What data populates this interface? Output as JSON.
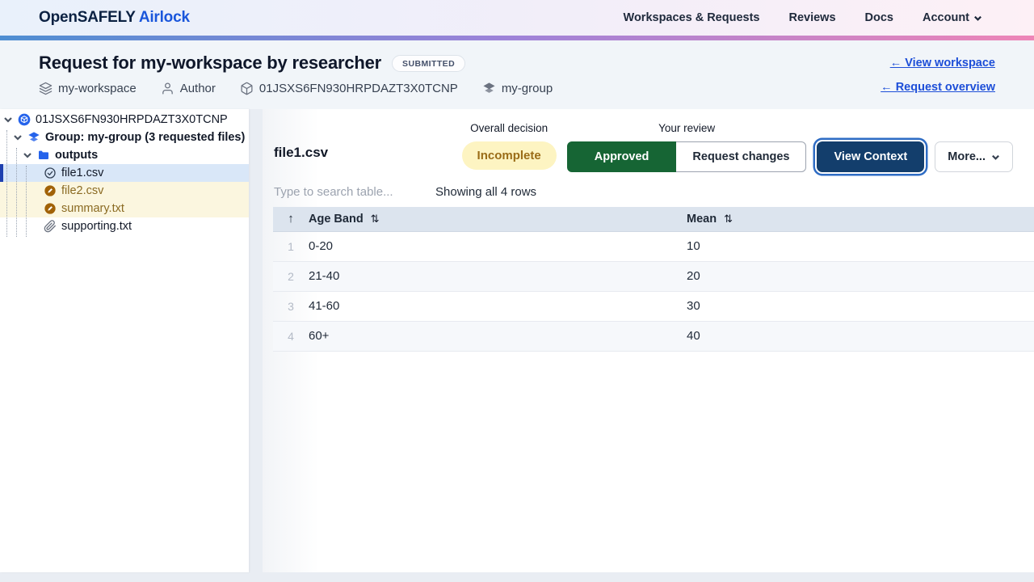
{
  "nav": {
    "brand_primary": "OpenSAFELY",
    "brand_secondary": "Airlock",
    "items": [
      {
        "label": "Workspaces & Requests"
      },
      {
        "label": "Reviews"
      },
      {
        "label": "Docs"
      },
      {
        "label": "Account"
      }
    ]
  },
  "header": {
    "title": "Request for my-workspace by researcher",
    "status_badge": "SUBMITTED",
    "meta": [
      {
        "icon": "layers-icon",
        "label": "my-workspace"
      },
      {
        "icon": "user-icon",
        "label": "Author"
      },
      {
        "icon": "package-icon",
        "label": "01JSXS6FN930HRPDAZT3X0TCNP"
      },
      {
        "icon": "stack-icon",
        "label": "my-group"
      }
    ],
    "links": [
      {
        "label": "← View workspace"
      },
      {
        "label": "← Request overview"
      }
    ]
  },
  "tree": {
    "root_label": "01JSXS6FN930HRPDAZT3X0TCNP",
    "group_label": "Group: my-group (3 requested files)",
    "folder_label": "outputs",
    "files": [
      {
        "name": "file1.csv",
        "status": "approved",
        "selected": true
      },
      {
        "name": "file2.csv",
        "status": "pending",
        "selected": false
      },
      {
        "name": "summary.txt",
        "status": "pending",
        "selected": false
      },
      {
        "name": "supporting.txt",
        "status": "supporting",
        "selected": false
      }
    ]
  },
  "panel": {
    "file_title": "file1.csv",
    "overall_decision_label": "Overall decision",
    "overall_decision_value": "Incomplete",
    "your_review_label": "Your review",
    "buttons": {
      "approved": "Approved",
      "request_changes": "Request changes",
      "view_context": "View Context",
      "more": "More..."
    },
    "search_placeholder": "Type to search table...",
    "rows_status": "Showing all 4 rows"
  },
  "table": {
    "columns": [
      {
        "label": "Age Band"
      },
      {
        "label": "Mean"
      }
    ],
    "sort_ascending_glyph": "↑",
    "rows": [
      {
        "num": "1",
        "age_band": "0-20",
        "mean": "10"
      },
      {
        "num": "2",
        "age_band": "21-40",
        "mean": "20"
      },
      {
        "num": "3",
        "age_band": "41-60",
        "mean": "30"
      },
      {
        "num": "4",
        "age_band": "60+",
        "mean": "40"
      }
    ]
  },
  "colors": {
    "approved_green": "#166534",
    "view_context_navy": "#133e6c",
    "focus_ring_blue": "#2e6cc4",
    "incomplete_bg": "#fdf4c2",
    "incomplete_text": "#9a6c17",
    "link_blue": "#1d4ed8",
    "brand_blue": "#1a56db",
    "selected_file_bg": "#d9e7f8",
    "selected_file_bar": "#1e40af",
    "pending_file_bg": "#fbf6df",
    "pending_file_text": "#8a6a22",
    "table_header_bg": "#dce4ee",
    "accent_gradient": [
      "#4e8ed2",
      "#9f82d8",
      "#ee85b7"
    ]
  }
}
